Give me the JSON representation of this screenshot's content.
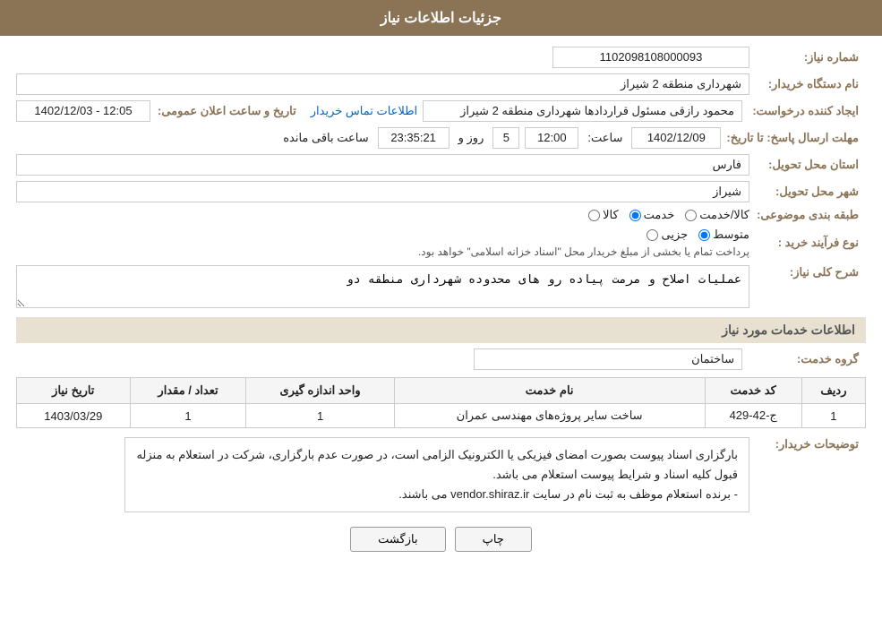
{
  "header": {
    "title": "جزئیات اطلاعات نیاز"
  },
  "fields": {
    "need_number_label": "شماره نیاز:",
    "need_number_value": "1102098108000093",
    "buyer_org_label": "نام دستگاه خریدار:",
    "buyer_org_value": "شهرداری منطقه 2 شیراز",
    "creator_label": "ایجاد کننده درخواست:",
    "creator_value": "محمود رازقی مسئول قراردادها شهرداری منطقه 2 شیراز",
    "creator_link": "اطلاعات تماس خریدار",
    "announce_label": "تاریخ و ساعت اعلان عمومی:",
    "announce_value": "1402/12/03 - 12:05",
    "send_deadline_label": "مهلت ارسال پاسخ: تا تاریخ:",
    "send_date": "1402/12/09",
    "send_time_label": "ساعت:",
    "send_time": "12:00",
    "send_days_label": "روز و",
    "send_days": "5",
    "send_remaining_label": "ساعت باقی مانده",
    "send_remaining_time": "23:35:21",
    "province_label": "استان محل تحویل:",
    "province_value": "فارس",
    "city_label": "شهر محل تحویل:",
    "city_value": "شیراز",
    "category_label": "طبقه بندی موضوعی:",
    "category_options": [
      {
        "label": "کالا",
        "value": "kala"
      },
      {
        "label": "خدمت",
        "value": "khadamat"
      },
      {
        "label": "کالا/خدمت",
        "value": "kala_khadamat"
      }
    ],
    "category_selected": "khadamat",
    "purchase_type_label": "نوع فرآیند خرید :",
    "purchase_type_options": [
      {
        "label": "جزیی",
        "value": "jozi"
      },
      {
        "label": "متوسط",
        "value": "mottavaset"
      }
    ],
    "purchase_type_selected": "mottavaset",
    "purchase_type_note": "پرداخت تمام یا بخشی از مبلغ خریدار محل \"اسناد خزانه اسلامی\" خواهد بود.",
    "need_description_label": "شرح کلی نیاز:",
    "need_description_value": "عملیات اصلاح و مرمت پیاده رو های محدوده شهرداری منطقه دو"
  },
  "services_section": {
    "title": "اطلاعات خدمات مورد نیاز",
    "group_label": "گروه خدمت:",
    "group_value": "ساختمان",
    "table_headers": [
      "ردیف",
      "کد خدمت",
      "نام خدمت",
      "واحد اندازه گیری",
      "تعداد / مقدار",
      "تاریخ نیاز"
    ],
    "table_rows": [
      {
        "row": "1",
        "code": "ج-42-429",
        "name": "ساخت سایر پروژه‌های مهندسی عمران",
        "unit": "1",
        "quantity": "1",
        "date": "1403/03/29"
      }
    ]
  },
  "buyer_notes_section": {
    "label": "توضیحات خریدار:",
    "line1": "بارگزاری اسناد پیوست بصورت امضای فیزیکی یا الکترونیک الزامی است، در صورت عدم بارگزاری، شرکت در استعلام به منزله",
    "line2": "قبول کلیه اسناد و شرایط پیوست استعلام می باشد.",
    "line3": "- برنده استعلام موظف به ثبت نام در سایت vendor.shiraz.ir می باشند."
  },
  "buttons": {
    "back_label": "بازگشت",
    "print_label": "چاپ"
  }
}
